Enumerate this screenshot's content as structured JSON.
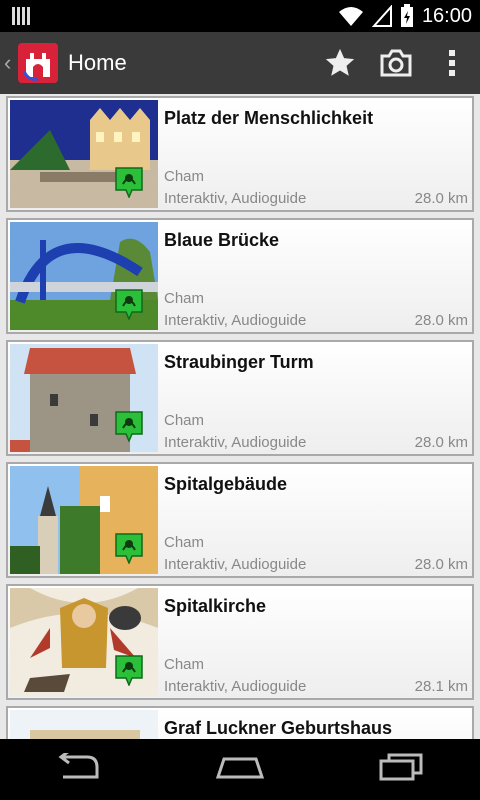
{
  "status_bar": {
    "time": "16:00"
  },
  "action_bar": {
    "title": "Home",
    "back_icon": "chevron-left-icon",
    "icons": [
      "star-icon",
      "camera-icon",
      "overflow-menu-icon"
    ]
  },
  "items": [
    {
      "title": "Platz der Menschlichkeit",
      "city": "Cham",
      "tags": "Interaktiv, Audioguide",
      "distance": "28.0 km"
    },
    {
      "title": "Blaue Brücke",
      "city": "Cham",
      "tags": "Interaktiv, Audioguide",
      "distance": "28.0 km"
    },
    {
      "title": "Straubinger Turm",
      "city": "Cham",
      "tags": "Interaktiv, Audioguide",
      "distance": "28.0 km"
    },
    {
      "title": "Spitalgebäude",
      "city": "Cham",
      "tags": "Interaktiv, Audioguide",
      "distance": "28.0 km"
    },
    {
      "title": "Spitalkirche",
      "city": "Cham",
      "tags": "Interaktiv, Audioguide",
      "distance": "28.1 km"
    },
    {
      "title": "Graf Luckner Geburtshaus",
      "city": "",
      "tags": "",
      "distance": ""
    }
  ],
  "nav_bar": {
    "icons": [
      "back-icon",
      "home-icon",
      "recent-apps-icon"
    ]
  },
  "colors": {
    "action_bar": "#3a3a3a",
    "badge": "#2bbf3a",
    "logo": "#d7223a"
  }
}
